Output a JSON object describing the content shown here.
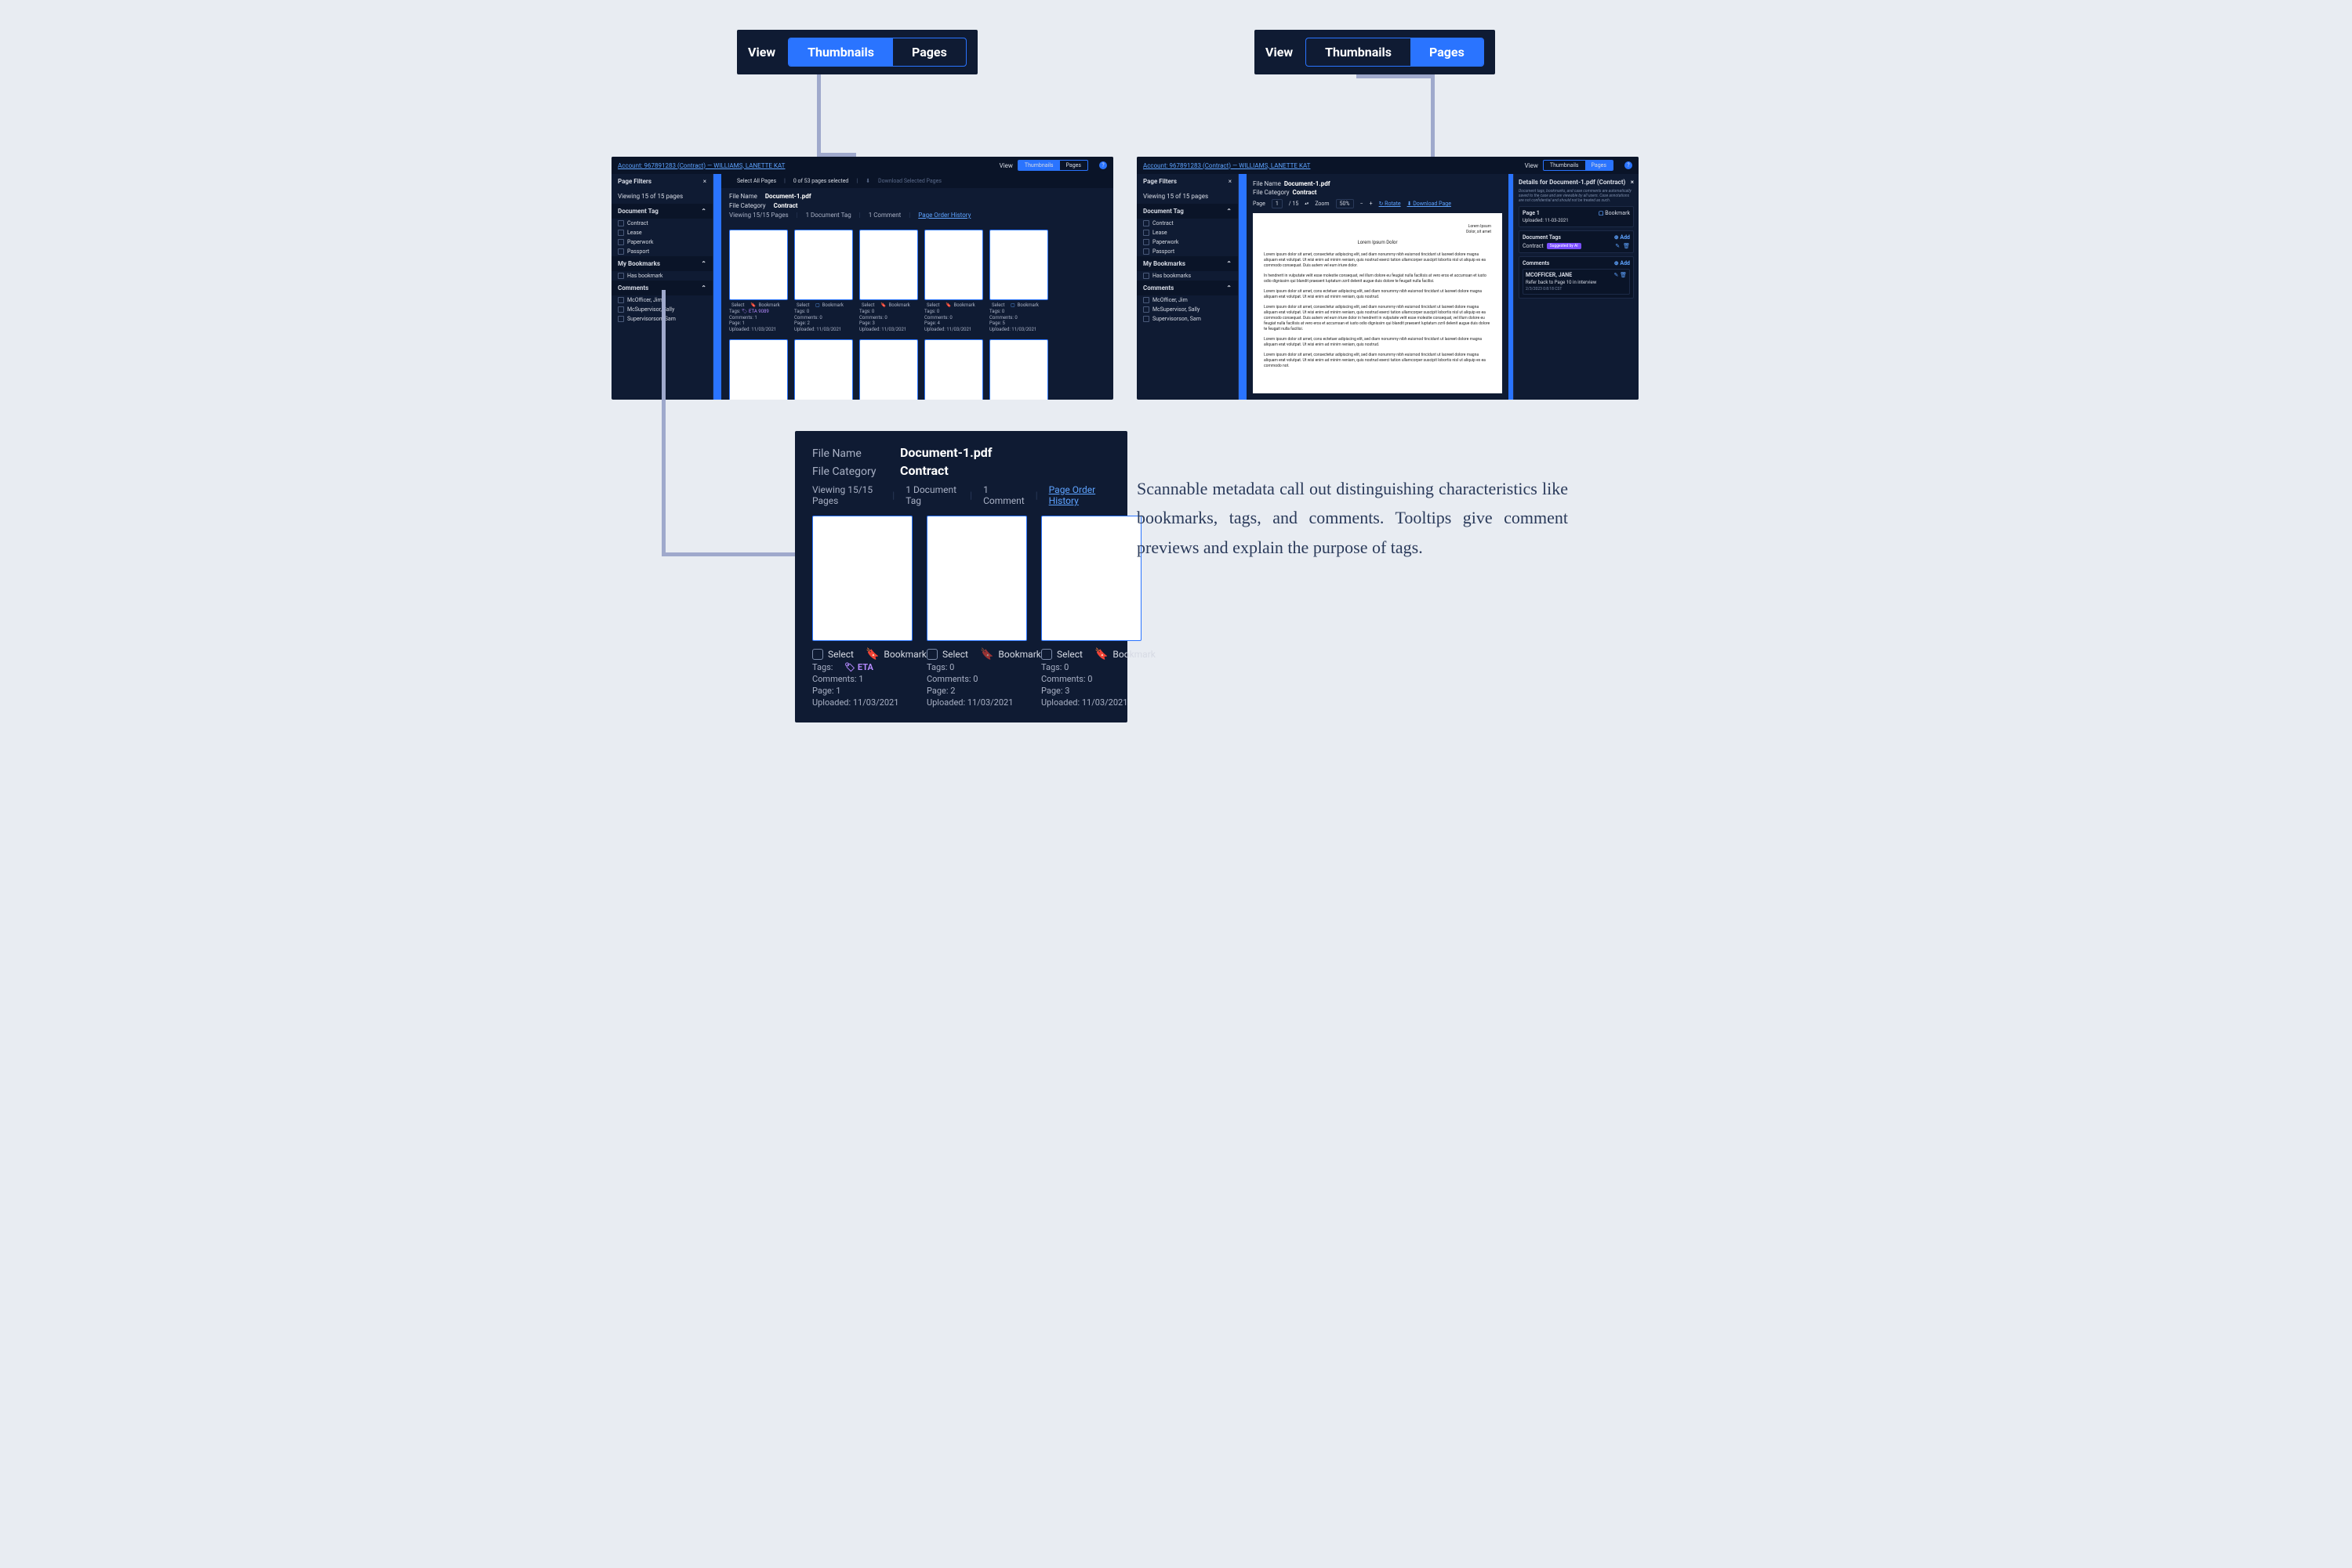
{
  "view_toggle_left": {
    "label": "View",
    "a": "Thumbnails",
    "b": "Pages"
  },
  "view_toggle_right": {
    "label": "View",
    "a": "Thumbnails",
    "b": "Pages"
  },
  "app_left": {
    "breadcrumb": "Account: 967891283 (Contract) — WILLIAMS, LANETTE KAT",
    "view_label": "View",
    "toggle_a": "Thumbnails",
    "toggle_b": "Pages",
    "help": "?",
    "sidebar": {
      "title": "Page Filters",
      "close": "×",
      "viewing": "Viewing 15 of 15 pages",
      "sec_doc_tag": "Document Tag",
      "tags": [
        "Contract",
        "Lease",
        "Paperwork",
        "Passport"
      ],
      "sec_bookmarks": "My Bookmarks",
      "bk_row": "Has bookmark",
      "sec_comments": "Comments",
      "auths": [
        "McOfficer, Jim",
        "McSupervisor, Sally",
        "Supervisorson, Sam"
      ]
    },
    "toolbar": {
      "select_all": "Select All Pages",
      "count": "0 of 53 pages selected",
      "download": "Download Selected Pages"
    },
    "metahdr": {
      "fn_k": "File Name",
      "fn_v": "Document-1.pdf",
      "fc_k": "File Category",
      "fc_v": "Contract",
      "viewing": "Viewing 15/15 Pages",
      "tags": "1 Document Tag",
      "comments": "1 Comment",
      "history": "Page Order History"
    },
    "thumbs": [
      {
        "select": "Select",
        "bookmark": "Bookmark",
        "bk_fill": true,
        "tags": "Tags:",
        "tagchip": "ETA 9089",
        "comments": "Comments: 1",
        "page": "Page: 1",
        "uploaded": "Uploaded: 11/03/2021"
      },
      {
        "select": "Select",
        "bookmark": "Bookmark",
        "bk_fill": false,
        "tags": "Tags: 0",
        "comments": "Comments: 0",
        "page": "Page: 2",
        "uploaded": "Uploaded: 11/03/2021"
      },
      {
        "select": "Select",
        "bookmark": "Bookmark",
        "bk_fill": true,
        "tags": "Tags: 0",
        "comments": "Comments: 0",
        "page": "Page: 3",
        "uploaded": "Uploaded: 11/03/2021"
      },
      {
        "select": "Select",
        "bookmark": "Bookmark",
        "bk_fill": true,
        "tags": "Tags: 0",
        "comments": "Comments: 0",
        "page": "Page: 4",
        "uploaded": "Uploaded: 11/03/2021"
      },
      {
        "select": "Select",
        "bookmark": "Bookmark",
        "bk_fill": false,
        "tags": "Tags: 0",
        "comments": "Comments: 0",
        "page": "Page: 5",
        "uploaded": "Uploaded: 11/03/2021"
      }
    ]
  },
  "app_right": {
    "breadcrumb": "Account: 967891283 (Contract) — WILLIAMS, LANETTE KAT",
    "view_label": "View",
    "toggle_a": "Thumbnails",
    "toggle_b": "Pages",
    "help": "?",
    "sidebar": {
      "title": "Page Filters",
      "close": "×",
      "viewing": "Viewing 15 of 15 pages",
      "sec_doc_tag": "Document Tag",
      "tags": [
        "Contract",
        "Lease",
        "Paperwork",
        "Passport"
      ],
      "sec_bookmarks": "My Bookmarks",
      "bk_row": "Has bookmarks",
      "sec_comments": "Comments",
      "auths": [
        "McOfficer, Jim",
        "McSupervisor, Sally",
        "Supervisorson, Sam"
      ]
    },
    "metahdr": {
      "fn_k": "File Name",
      "fn_v": "Document-1.pdf",
      "fc_k": "File Category",
      "fc_v": "Contract"
    },
    "pagebar": {
      "pg_k": "Page",
      "pg_v": "1",
      "tot": "/ 15",
      "zm_k": "Zoom",
      "zm_v": "50%",
      "rot": "Rotate",
      "dl": "Download Page"
    },
    "paper": {
      "from": "Lorem Ipsum",
      "addr": "Dolor, sit amet",
      "title": "Lorem Ipsum Dolor",
      "p1": "Lorem ipsum dolor sit amet, consectetur adipiscing elit, sed diam nonummy nibh euismod tincidunt ut laoreet dolore magna aliquam erat volutpat. Ut wisi enim ad minim veniam, quis nostrud exerci tation ullamcorper suscipit lobortis nisl ut aliquip ex ea commodo consequat. Duis autem vel eum iriure dolor.",
      "p2": "In hendrerit in vulputate velit esse molestie consequat, vel illum dolore eu feugiat nulla facilisis at vero eros et accumsan et iusto odio dignissim qui blandit praesent luptatum zzril delenit augue duis dolore te feugait nulla facilisi.",
      "p3": "Lorem ipsum dolor sit amet, cons ectetuer adipiscing elit, sed diam nonummy nibh euismod tincidunt ut laoreet dolore magna aliquam erat volutpat. Ut wisi enim ad minim veniam, quis nostrud.",
      "p4": "Lorem ipsum dolor sit amet, consectetur adipiscing elit, sed diam nonummy nibh euismod tincidunt ut laoreet dolore magna aliquam erat volutpat. Ut wisi enim ad minim veniam, quis nostrud exerci tation ullamcorper suscipit lobortis nisl ut aliquip ex ea commodo consequat. Duis autem vel eum iriure dolor in hendrerit in vulputate velit esse molestie consequat, vel illum dolore eu feugiat nulla facilisis at vero eros et accumsan et iusto odio dignissim qui blandit praesent luptatum zzril delenit augue duis dolore te feugait nulla facilisi.",
      "p5": "Lorem ipsum dolor sit amet, cons ectetuer adipiscing elit, sed diam nonummy nibh euismod tincidunt ut laoreet dolore magna aliquam erat volutpat. Ut wisi enim ad minim veniam, quis nostrud.",
      "p6": "Lorem ipsum dolor sit amet, consectetur adipiscing elit, sed diam nonummy nibh euismod tincidunt ut laoreet dolore magna aliquam erat volutpat. Ut wisi enim ad minim veniam, quis nostrud exerci tation ullamcorper suscipit lobortis nisl ut aliquip ex ea commodo not."
    },
    "details": {
      "title": "Details for Document-1.pdf (Contract)",
      "close": "×",
      "disclaimer": "Document tags, bookmarks, and case comments are automatically saved to the case and are viewable by all users. Case annotations are not confidential and should not be treated as such.",
      "page_head": "Page 1",
      "bookmark": "Bookmark",
      "uploaded": "Uploaded: 11-03-2021",
      "doctags_hdr": "Document Tags",
      "add": "Add",
      "chip_label": "Contract",
      "chip_badge": "Suggested by AI",
      "comments_hdr": "Comments",
      "commenter": "MCOFFICER, JANE",
      "comment": "Refer back to Page 10 in interview",
      "timestamp": "2/3/2023 0:8:18 CST"
    }
  },
  "bigcard": {
    "fn_k": "File Name",
    "fn_v": "Document-1.pdf",
    "fc_k": "File Category",
    "fc_v": "Contract",
    "viewing": "Viewing 15/15 Pages",
    "tags": "1 Document Tag",
    "comments": "1 Comment",
    "history": "Page Order History",
    "cards": [
      {
        "select": "Select",
        "bookmark": "Bookmark",
        "bk_fill": true,
        "tags_k": "Tags:",
        "tagchip": "ETA",
        "comments": "Comments: 1",
        "page": "Page: 1",
        "uploaded": "Uploaded: 11/03/2021"
      },
      {
        "select": "Select",
        "bookmark": "Bookmark",
        "bk_fill": false,
        "tags_k": "Tags: 0",
        "comments": "Comments: 0",
        "page": "Page: 2",
        "uploaded": "Uploaded: 11/03/2021"
      },
      {
        "select": "Select",
        "bookmark": "Bookmark",
        "bk_fill": true,
        "tags_k": "Tags: 0",
        "comments": "Comments: 0",
        "page": "Page: 3",
        "uploaded": "Uploaded: 11/03/2021"
      }
    ]
  },
  "annotation": "Scannable metadata call out distinguishing characteristics like bookmarks, tags, and comments. Tooltips give comment previews and explain the purpose of tags."
}
